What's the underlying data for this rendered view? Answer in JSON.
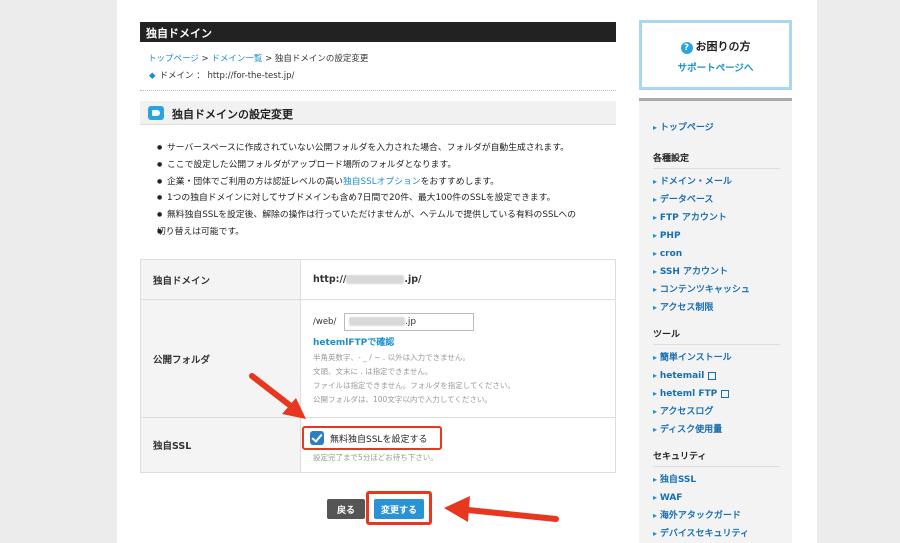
{
  "header": {
    "title": "独自ドメイン"
  },
  "breadcrumb": {
    "top": "トップページ",
    "sep": ">",
    "list": "ドメイン一覧",
    "current": "独自ドメインの設定変更"
  },
  "domain_line": {
    "label": "ドメイン ： http://for-the-test.jp/"
  },
  "box": {
    "title": "独自ドメインの設定変更"
  },
  "notes": [
    "サーバースペースに作成されていない公開フォルダを入力された場合、フォルダが自動生成されます。",
    "ここで設定した公開フォルダがアップロード場所のフォルダとなります。",
    "企業・団体でご利用の方は認証レベルの高い",
    "1つの独自ドメインに対してサブドメインも含め7日間で20件、最大100件のSSLを設定できます。",
    "無料独自SSLを設定後、解除の操作は行っていただけませんが、ヘテムルで提供している有料のSSLへの",
    "切り替えは可能です。"
  ],
  "note_link": "独自SSLオプション",
  "note_suffix": "をおすすめします。",
  "form": {
    "domain_label": "独自ドメイン",
    "domain_prefix": "http://",
    "domain_suffix": ".jp/",
    "folder_label": "公開フォルダ",
    "folder_prefix": "/web/",
    "folder_suffix": ".jp",
    "ftp_link": "hetemlFTPで確認",
    "rules": [
      "半角英数字、- _ / ~ . 以外は入力できません。",
      "文頭、文末に . は指定できません。",
      "ファイルは指定できません。フォルダを指定してください。",
      "公開フォルダは、100文字以内で入力してください。"
    ],
    "ssl_label": "独自SSL",
    "ssl_checkbox": "無料独自SSLを設定する",
    "ssl_note": "設定完了まで5分ほどお待ち下さい。"
  },
  "buttons": {
    "back": "戻る",
    "save": "変更する"
  },
  "aside": {
    "help_title": "お困りの方",
    "help_link": "サポートページへ",
    "top": "トップページ",
    "groups": [
      {
        "head": "各種設定",
        "items": [
          "ドメイン・メール",
          "データベース",
          "FTP アカウント",
          "PHP",
          "cron",
          "SSH アカウント",
          "コンテンツキャッシュ",
          "アクセス制限"
        ]
      },
      {
        "head": "ツール",
        "items": [
          "簡単インストール",
          "hetemail",
          "heteml FTP",
          "アクセスログ",
          "ディスク使用量"
        ]
      },
      {
        "head": "セキュリティ",
        "items": [
          "独自SSL",
          "WAF",
          "海外アタックガード",
          "デバイスセキュリティ"
        ]
      }
    ]
  },
  "colors": {
    "accent": "#1a8fc9",
    "highlight": "#e8371f",
    "header": "#222222"
  }
}
